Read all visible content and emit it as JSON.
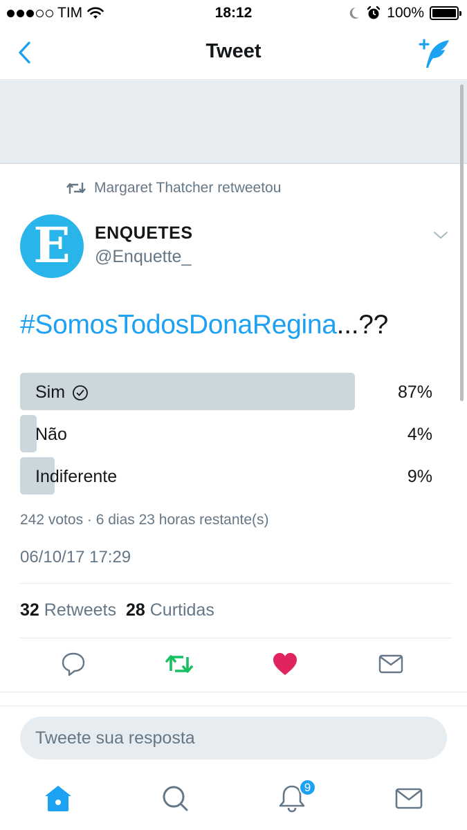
{
  "status_bar": {
    "carrier": "TIM",
    "time": "18:12",
    "battery": "100%",
    "signal_bars_filled": 3,
    "signal_bars_total": 5
  },
  "nav": {
    "title": "Tweet",
    "back_icon": "chevron-left-icon",
    "compose_icon": "compose-tweet-icon"
  },
  "retweet_context": {
    "text": "Margaret Thatcher retweetou"
  },
  "author": {
    "name": "ENQUETES",
    "handle": "@Enquette_",
    "avatar_letter": "E"
  },
  "tweet": {
    "hashtag": "#SomosTodosDonaRegina",
    "text_rest": "...??"
  },
  "poll": {
    "options": [
      {
        "label": "Sim",
        "percent_text": "87%",
        "percent": 87,
        "winner": true
      },
      {
        "label": "Não",
        "percent_text": "4%",
        "percent": 4,
        "winner": false
      },
      {
        "label": "Indiferente",
        "percent_text": "9%",
        "percent": 9,
        "winner": false
      }
    ],
    "meta": "242 votos · 6 dias 23 horas restante(s)"
  },
  "timestamp": "06/10/17 17:29",
  "stats": {
    "retweets_count": "32",
    "retweets_label": "Retweets",
    "likes_count": "28",
    "likes_label": "Curtidas"
  },
  "reply": {
    "placeholder": "Tweete sua resposta"
  },
  "tabbar": {
    "notifications_badge": "9"
  },
  "colors": {
    "accent": "#1da1f2",
    "retweet": "#17bf63",
    "like": "#e0245e",
    "muted": "#657786",
    "poll_bar": "#ccd6dd"
  }
}
